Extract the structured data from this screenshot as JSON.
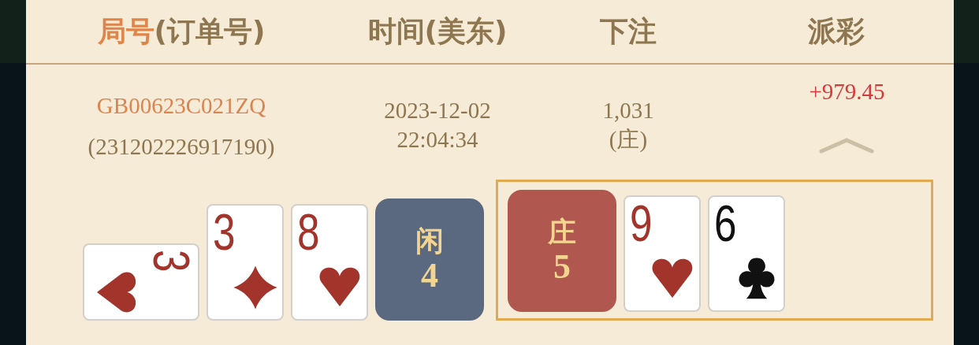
{
  "columns": [
    {
      "label": "局号",
      "suffix": "(订单号)",
      "highlighted": true
    },
    {
      "label": "时间(美东)",
      "highlighted": false
    },
    {
      "label": "下注",
      "highlighted": false
    },
    {
      "label": "派彩",
      "highlighted": false
    }
  ],
  "row": {
    "round_id": "GB00623C021ZQ",
    "order_id": "(231202226917190)",
    "date": "2023-12-02",
    "time": "22:04:34",
    "bet": "1,031",
    "bet_side": "(庄)",
    "payout": "+979.45",
    "expanded": true
  },
  "hands": [
    {
      "kind": "player",
      "label": "闲",
      "total": "4",
      "winner": false,
      "cards": [
        {
          "rank": "3",
          "kind": "hearts",
          "sideways": true
        },
        {
          "rank": "3",
          "kind": "diamonds",
          "sideways": false
        },
        {
          "rank": "8",
          "kind": "hearts",
          "sideways": false
        }
      ]
    },
    {
      "kind": "banker",
      "label": "庄",
      "total": "5",
      "winner": true,
      "cards": [
        {
          "rank": "9",
          "kind": "hearts",
          "sideways": false
        },
        {
          "rank": "6",
          "kind": "clubs",
          "sideways": false
        }
      ]
    }
  ]
}
